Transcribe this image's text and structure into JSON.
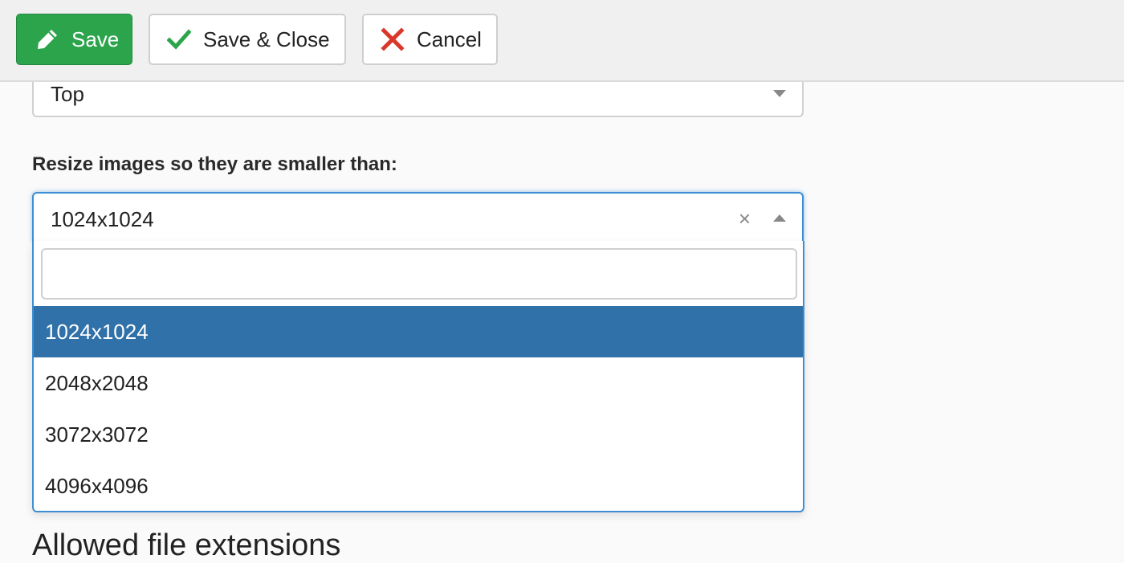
{
  "toolbar": {
    "save_label": "Save",
    "save_close_label": "Save & Close",
    "cancel_label": "Cancel"
  },
  "position_select": {
    "value": "Top"
  },
  "resize": {
    "label": "Resize images so they are smaller than:",
    "value": "1024x1024",
    "search_value": "",
    "options": [
      "1024x1024",
      "2048x2048",
      "3072x3072",
      "4096x4096"
    ],
    "highlighted_index": 0
  },
  "section": {
    "heading": "Allowed file extensions"
  },
  "colors": {
    "save_green": "#2ba44c",
    "check_green": "#2ba44c",
    "cancel_red": "#d9372b",
    "focus_blue": "#3d8ed4",
    "highlight_blue": "#3071a9"
  },
  "icons": {
    "save": "pencil-icon",
    "save_close": "checkmark-icon",
    "cancel": "close-icon",
    "clear": "clear-icon",
    "dropdown_closed": "caret-down-icon",
    "dropdown_open": "caret-up-icon"
  }
}
